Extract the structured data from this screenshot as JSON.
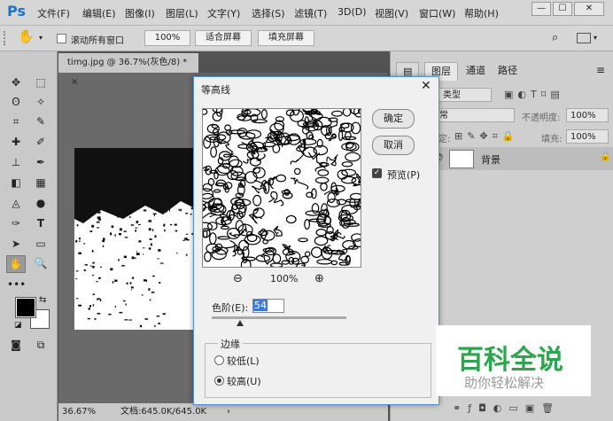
{
  "app": {
    "logo": "Ps"
  },
  "menu": {
    "items": [
      "文件(F)",
      "编辑(E)",
      "图像(I)",
      "图层(L)",
      "文字(Y)",
      "选择(S)",
      "滤镜(T)",
      "3D(D)",
      "视图(V)",
      "窗口(W)",
      "帮助(H)"
    ]
  },
  "window_controls": {
    "minimize": "—",
    "maximize": "☐",
    "close": "✕"
  },
  "options_bar": {
    "scroll_all_label": "滚动所有窗口",
    "zoom_value": "100%",
    "fit_screen_label": "适合屏幕",
    "fill_screen_label": "填充屏幕"
  },
  "document": {
    "tab_title": "timg.jpg @ 36.7%(灰色/8) *",
    "tab_close": "×",
    "status_zoom": "36.67%",
    "status_doc": "文档:645.0K/645.0K"
  },
  "panels": {
    "tabs": [
      "图层",
      "通道",
      "路径"
    ],
    "kind_label": "类型",
    "blend_mode": "正常",
    "opacity_label": "不透明度:",
    "opacity_value": "100%",
    "lock_label": "锁定:",
    "fill_label": "填充:",
    "fill_value": "100%",
    "layer_name": "背景"
  },
  "dialog": {
    "title": "等高线",
    "close": "✕",
    "ok_label": "确定",
    "cancel_label": "取消",
    "preview_label": "预览(P)",
    "preview_checked": true,
    "zoom_value": "100%",
    "level_label": "色阶(E):",
    "level_value": "54",
    "level_max": 255,
    "edge_label": "边缘",
    "lower_label": "较低(L)",
    "upper_label": "较高(U)",
    "selected_edge": "upper"
  },
  "watermark": {
    "title": "百科全说",
    "subtitle": "助你轻松解决"
  },
  "colors": {
    "accent": "#1c74c4",
    "watermark_green": "#2da44e",
    "dialog_border": "#5a8fd6"
  }
}
